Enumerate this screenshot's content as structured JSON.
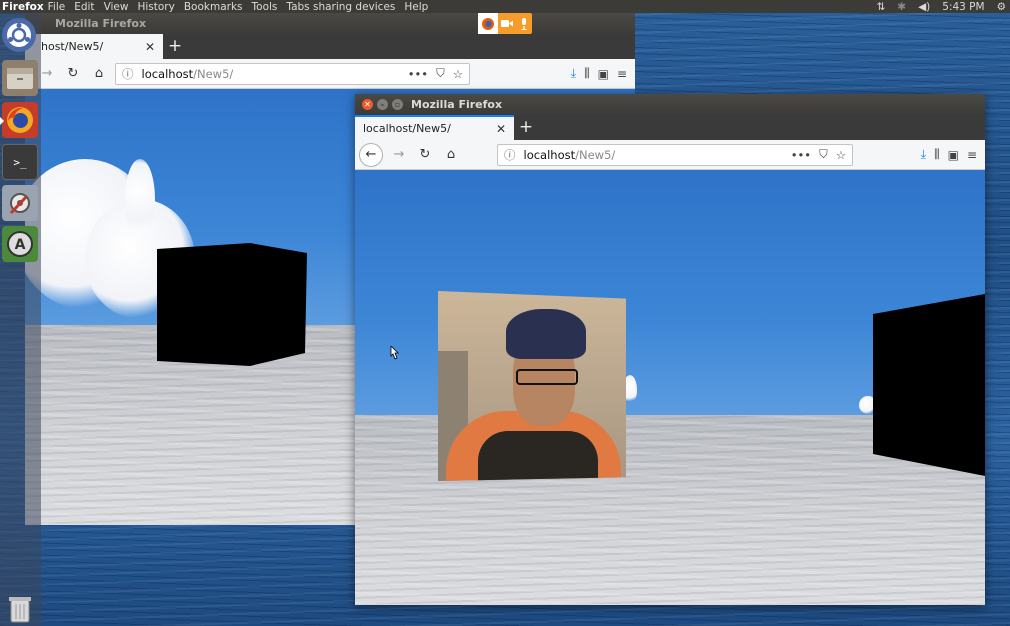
{
  "top_panel": {
    "app_name": "Firefox",
    "menu": [
      "File",
      "Edit",
      "View",
      "History",
      "Bookmarks",
      "Tools",
      "Tabs sharing devices",
      "Help"
    ],
    "time": "5:43 PM"
  },
  "sharing_indicator": {
    "icons": [
      "firefox-icon",
      "camera-icon",
      "microphone-icon"
    ],
    "colors": {
      "accent": "#f59c2a"
    }
  },
  "launcher": {
    "items": [
      "ubuntu-home-icon",
      "files-icon",
      "firefox-icon",
      "terminal-icon",
      "system-settings-icon",
      "software-updater-icon",
      "trash-icon"
    ]
  },
  "back_window": {
    "title": "Mozilla Firefox",
    "tab_label": "host/New5/",
    "url_host": "localhost",
    "url_path": "/New5/"
  },
  "front_window": {
    "title": "Mozilla Firefox",
    "tab_label": "localhost/New5/",
    "url_host": "localhost",
    "url_path": "/New5/"
  },
  "colors": {
    "sky": "#2e73c8",
    "ground": "#cfd1d5",
    "panel": "#3c3b37",
    "close_button": "#e85d2c"
  }
}
